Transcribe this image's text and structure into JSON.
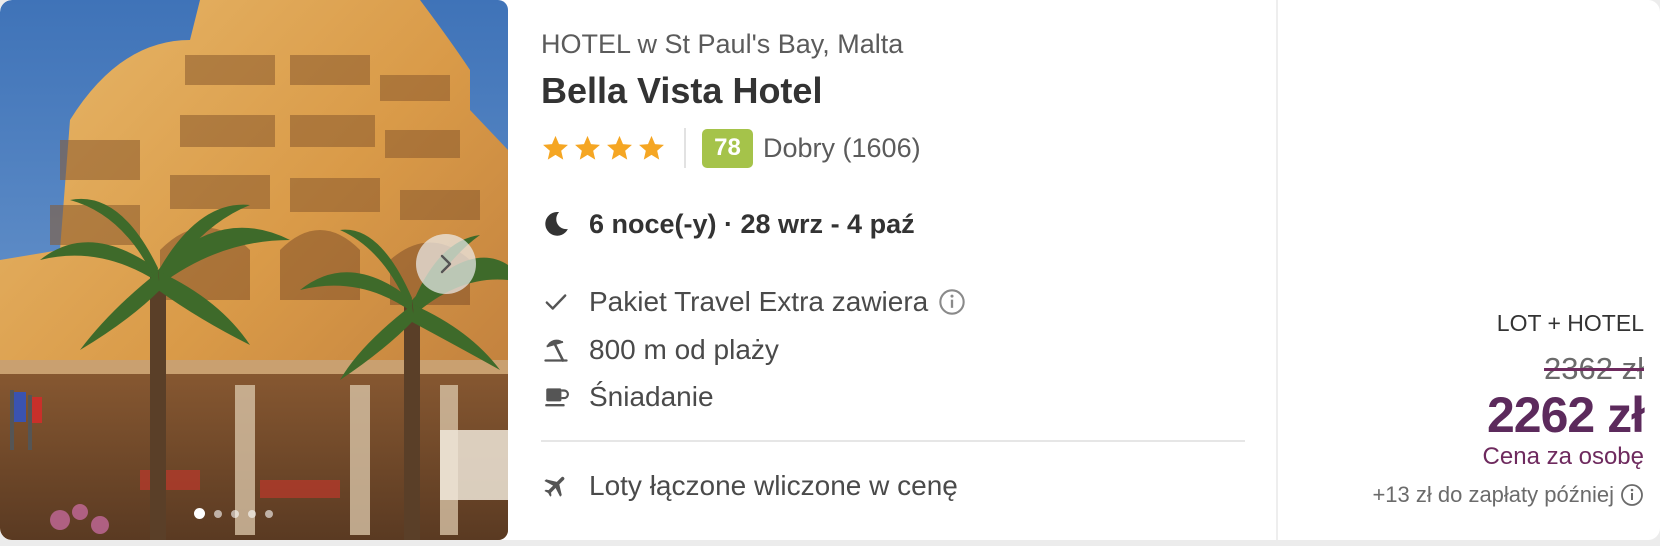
{
  "hotel": {
    "type_location": "HOTEL w St Paul's Bay, Malta",
    "name": "Bella Vista Hotel",
    "stars": 4,
    "score": "78",
    "score_label": "Dobry (1606)",
    "stay": "6 noce(-y) · 28 wrz - 4 paź"
  },
  "features": [
    {
      "icon": "check-icon",
      "label": "Pakiet Travel Extra zawiera",
      "has_info": true
    },
    {
      "icon": "beach-umbrella-icon",
      "label": "800 m od plaży",
      "has_info": false
    },
    {
      "icon": "coffee-cup-icon",
      "label": "Śniadanie",
      "has_info": false
    }
  ],
  "flights": {
    "icon": "plane-icon",
    "label": "Loty łączone wliczone w cenę"
  },
  "price": {
    "package_type": "LOT + HOTEL",
    "old_price": "2362 zł",
    "new_price": "2262 zł",
    "per_person": "Cena za osobę",
    "extra_fee": "+13 zł do zapłaty później"
  },
  "gallery": {
    "image_count": 5,
    "active_index": 0
  },
  "colors": {
    "score_badge": "#a5c34a",
    "star": "#f5a623",
    "price": "#5c2a5c",
    "price_accent": "#6e2a5e"
  }
}
